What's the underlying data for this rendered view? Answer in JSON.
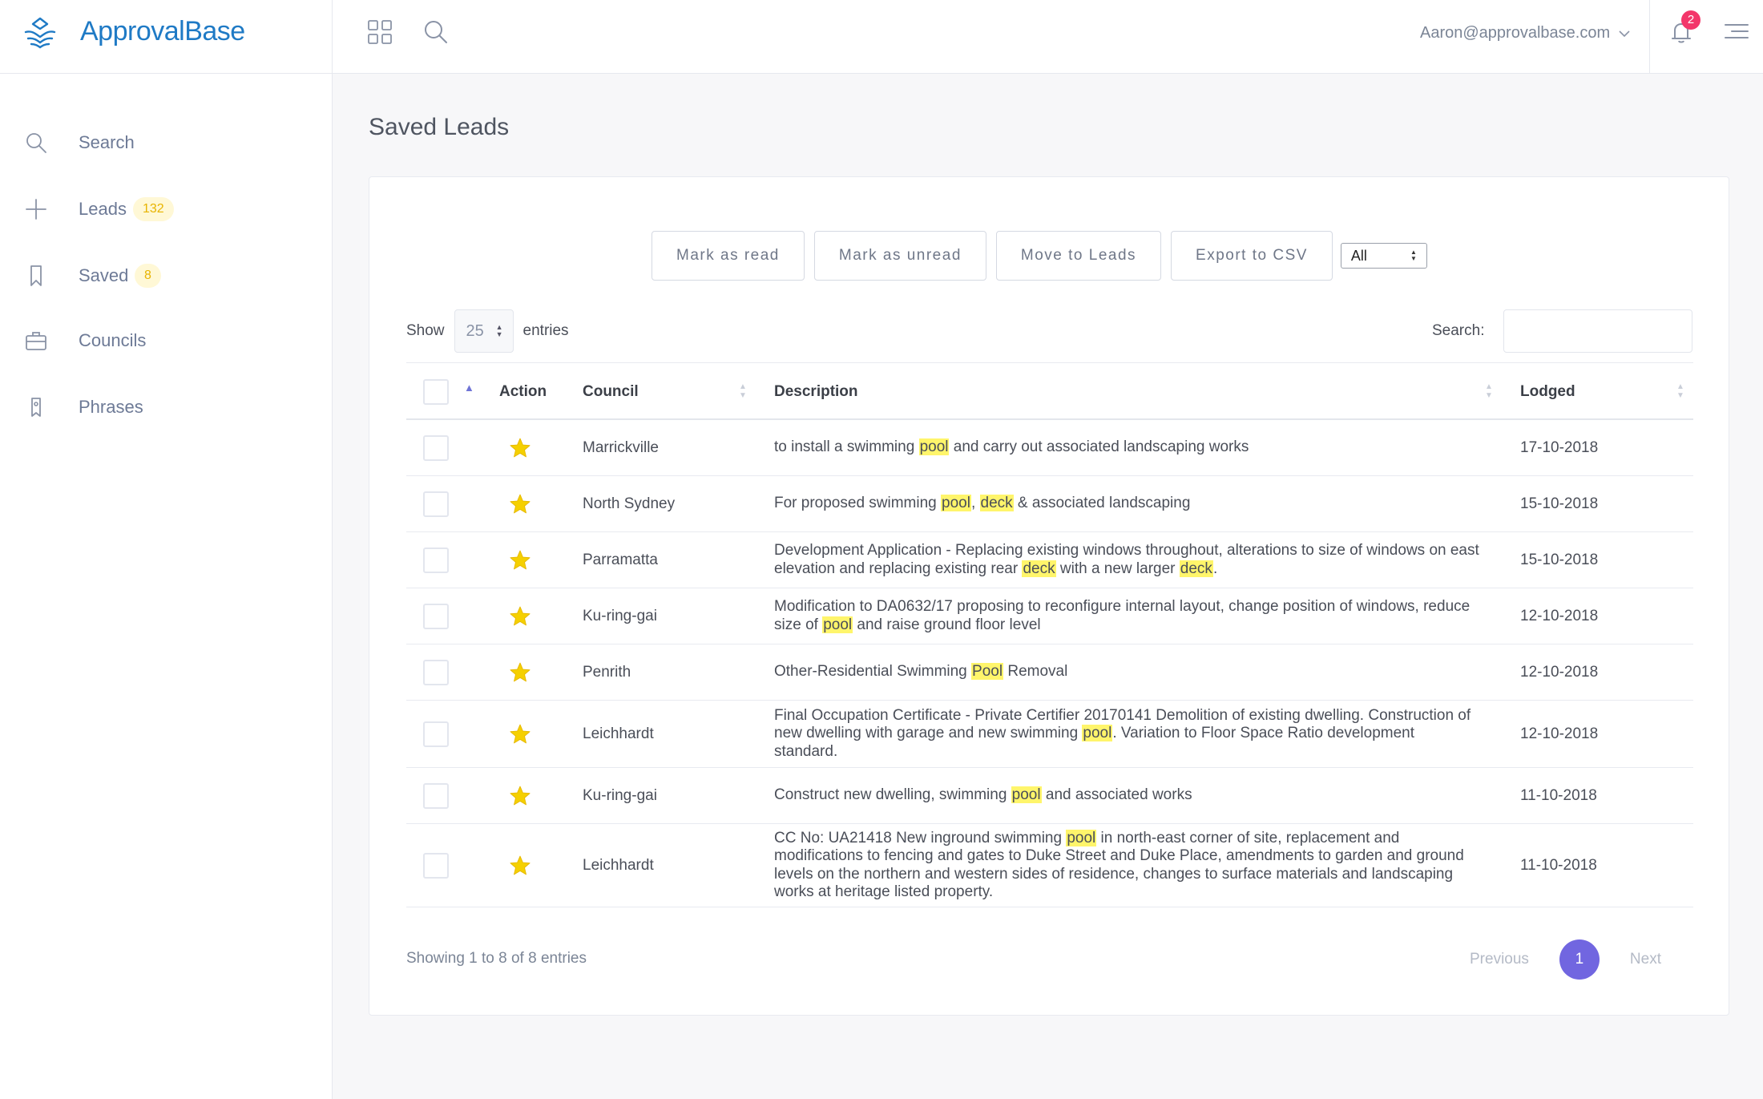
{
  "brand": {
    "name": "ApprovalBase"
  },
  "topbar": {
    "user_email": "Aaron@approvalbase.com",
    "notification_count": "2",
    "icons": [
      "apps-grid-icon",
      "search-icon",
      "chevron-down-icon",
      "bell-icon",
      "menu-icon"
    ]
  },
  "sidebar": {
    "items": [
      {
        "label": "Search",
        "icon": "search-icon",
        "badge": ""
      },
      {
        "label": "Leads",
        "icon": "plus-icon",
        "badge": "132"
      },
      {
        "label": "Saved",
        "icon": "bookmark-icon",
        "badge": "8"
      },
      {
        "label": "Councils",
        "icon": "briefcase-icon",
        "badge": ""
      },
      {
        "label": "Phrases",
        "icon": "tag-icon",
        "badge": ""
      }
    ]
  },
  "page": {
    "title": "Saved Leads"
  },
  "toolbar": {
    "mark_read": "Mark as read",
    "mark_unread": "Mark as unread",
    "move_leads": "Move to Leads",
    "export_csv": "Export to CSV",
    "filter_value": "All"
  },
  "table_controls": {
    "show_label": "Show",
    "page_length": "25",
    "entries_label": "entries",
    "search_label": "Search:",
    "search_value": ""
  },
  "table": {
    "columns": {
      "action": "Action",
      "council": "Council",
      "description": "Description",
      "lodged": "Lodged"
    },
    "highlight_color": "#fff56b",
    "star_color": "#f5d000",
    "rows": [
      {
        "council": "Marrickville",
        "description": "to install a swimming [pool] and carry out associated landscaping works",
        "lodged": "17-10-2018"
      },
      {
        "council": "North Sydney",
        "description": "For proposed swimming [pool], [deck] & associated landscaping",
        "lodged": "15-10-2018"
      },
      {
        "council": "Parramatta",
        "description": "Development Application - Replacing existing windows throughout, alterations to size of windows on east elevation and replacing existing rear [deck] with a new larger [deck].",
        "lodged": "15-10-2018"
      },
      {
        "council": "Ku-ring-gai",
        "description": "Modification to DA0632/17 proposing to reconfigure internal layout, change position of windows, reduce size of [pool] and raise ground floor level",
        "lodged": "12-10-2018"
      },
      {
        "council": "Penrith",
        "description": "Other-Residential Swimming [Pool] Removal",
        "lodged": "12-10-2018"
      },
      {
        "council": "Leichhardt",
        "description": "Final Occupation Certificate - Private Certifier 20170141 Demolition of existing dwelling. Construction of new dwelling with garage and new swimming [pool]. Variation to Floor Space Ratio development standard.",
        "lodged": "12-10-2018"
      },
      {
        "council": "Ku-ring-gai",
        "description": "Construct new dwelling, swimming [pool] and associated works",
        "lodged": "11-10-2018"
      },
      {
        "council": "Leichhardt",
        "description": "CC No: UA21418 New inground swimming [pool] in north-east corner of site, replacement and modifications to fencing and gates to Duke Street and Duke Place, amendments to garden and ground levels on the northern and western sides of residence, changes to surface materials and landscaping works at heritage listed property.",
        "lodged": "11-10-2018"
      }
    ]
  },
  "pagination": {
    "info": "Showing 1 to 8 of 8 entries",
    "previous": "Previous",
    "current": "1",
    "next": "Next",
    "active_color": "#7166e0"
  }
}
